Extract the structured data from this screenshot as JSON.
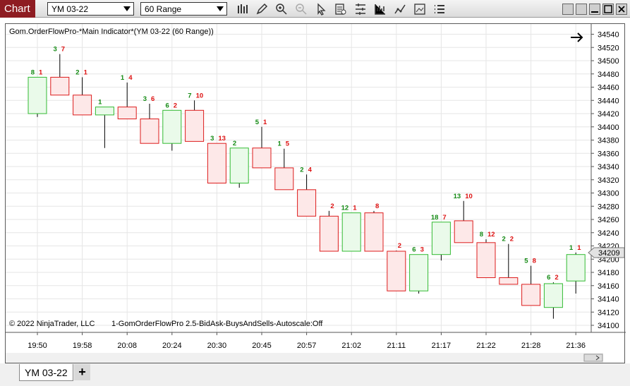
{
  "app": {
    "tab_label": "Chart"
  },
  "toolbar": {
    "instrument": "YM 03-22",
    "interval": "60 Range",
    "icons": [
      "bar-type-icon",
      "pencil-icon",
      "zoom-in-icon",
      "zoom-out-icon",
      "cursor-icon",
      "data-box-icon",
      "properties-icon",
      "indicators-icon",
      "strategies-icon",
      "snapshot-icon",
      "menu-icon"
    ]
  },
  "chart": {
    "header": "Gom.OrderFlowPro-*Main Indicator*(YM 03-22 (60 Range))",
    "copyright": "© 2022 NinjaTrader, LLC",
    "footer_note": "1-GomOrderFlowPro 2.5-BidAsk-BuysAndSells-Autoscale:Off",
    "current_price": "34209",
    "colors": {
      "up_fill": "#eafaea",
      "up_border": "#33bb33",
      "down_fill": "#fde8e8",
      "down_border": "#dd1c1c",
      "buy_text": "#138a13",
      "sell_text": "#dd1111",
      "grid": "#e6e6e6"
    }
  },
  "chart_data": {
    "type": "candlestick",
    "y_ticks": [
      34540,
      34520,
      34500,
      34480,
      34460,
      34440,
      34420,
      34400,
      34380,
      34360,
      34340,
      34320,
      34300,
      34280,
      34260,
      34240,
      34220,
      34200,
      34180,
      34160,
      34140,
      34120,
      34100
    ],
    "x_ticks": [
      "19:50",
      "19:58",
      "20:08",
      "20:24",
      "20:30",
      "20:45",
      "20:57",
      "21:02",
      "21:11",
      "21:17",
      "21:22",
      "21:28",
      "21:36"
    ],
    "candles": [
      {
        "open": 34420,
        "high": 34475,
        "low": 34415,
        "close": 34475,
        "buy": "8",
        "sell": "1"
      },
      {
        "open": 34475,
        "high": 34510,
        "low": 34448,
        "close": 34448,
        "buy": "3",
        "sell": "7"
      },
      {
        "open": 34448,
        "high": 34475,
        "low": 34418,
        "close": 34418,
        "buy": "2",
        "sell": "1"
      },
      {
        "open": 34418,
        "high": 34430,
        "low": 34368,
        "close": 34430,
        "buy": "1",
        "sell": ""
      },
      {
        "open": 34430,
        "high": 34467,
        "low": 34412,
        "close": 34412,
        "buy": "1",
        "sell": "4"
      },
      {
        "open": 34412,
        "high": 34435,
        "low": 34375,
        "close": 34375,
        "buy": "3",
        "sell": "6"
      },
      {
        "open": 34375,
        "high": 34425,
        "low": 34364,
        "close": 34425,
        "buy": "6",
        "sell": "2"
      },
      {
        "open": 34425,
        "high": 34440,
        "low": 34378,
        "close": 34378,
        "buy": "7",
        "sell": "10"
      },
      {
        "open": 34375,
        "high": 34375,
        "low": 34315,
        "close": 34315,
        "buy": "3",
        "sell": "13"
      },
      {
        "open": 34315,
        "high": 34368,
        "low": 34308,
        "close": 34368,
        "buy": "2",
        "sell": ""
      },
      {
        "open": 34368,
        "high": 34400,
        "low": 34338,
        "close": 34338,
        "buy": "5",
        "sell": "1"
      },
      {
        "open": 34338,
        "high": 34367,
        "low": 34305,
        "close": 34305,
        "buy": "1",
        "sell": "5"
      },
      {
        "open": 34305,
        "high": 34328,
        "low": 34265,
        "close": 34265,
        "buy": "2",
        "sell": "4"
      },
      {
        "open": 34265,
        "high": 34273,
        "low": 34212,
        "close": 34212,
        "buy": "",
        "sell": "2"
      },
      {
        "open": 34212,
        "high": 34270,
        "low": 34212,
        "close": 34270,
        "buy": "12",
        "sell": "1"
      },
      {
        "open": 34270,
        "high": 34273,
        "low": 34212,
        "close": 34212,
        "buy": "",
        "sell": "8"
      },
      {
        "open": 34212,
        "high": 34213,
        "low": 34152,
        "close": 34152,
        "buy": "",
        "sell": "2"
      },
      {
        "open": 34152,
        "high": 34207,
        "low": 34148,
        "close": 34207,
        "buy": "6",
        "sell": "3"
      },
      {
        "open": 34207,
        "high": 34256,
        "low": 34198,
        "close": 34256,
        "buy": "18",
        "sell": "7"
      },
      {
        "open": 34258,
        "high": 34288,
        "low": 34225,
        "close": 34225,
        "buy": "13",
        "sell": "10"
      },
      {
        "open": 34225,
        "high": 34230,
        "low": 34172,
        "close": 34172,
        "buy": "8",
        "sell": "12"
      },
      {
        "open": 34172,
        "high": 34223,
        "low": 34162,
        "close": 34162,
        "buy": "2",
        "sell": "2"
      },
      {
        "open": 34162,
        "high": 34190,
        "low": 34130,
        "close": 34130,
        "buy": "5",
        "sell": "8"
      },
      {
        "open": 34127,
        "high": 34165,
        "low": 34110,
        "close": 34163,
        "buy": "6",
        "sell": "2"
      },
      {
        "open": 34167,
        "high": 34210,
        "low": 34148,
        "close": 34207,
        "buy": "1",
        "sell": "1"
      }
    ]
  }
}
